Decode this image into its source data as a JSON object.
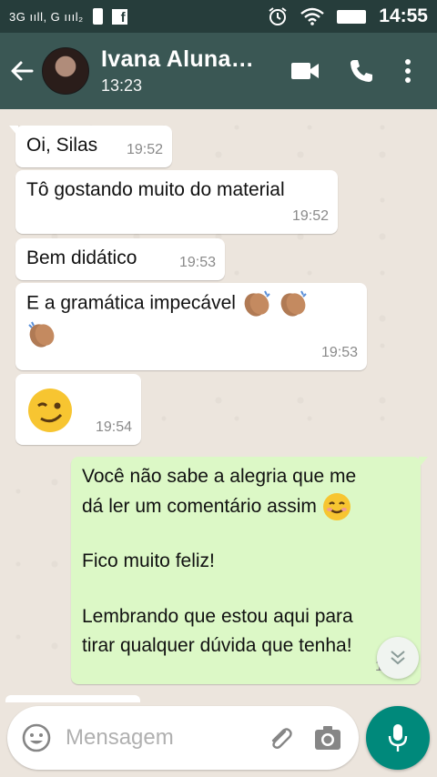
{
  "status_bar": {
    "signal_text": "3G ııll, G ıııl₂",
    "time": "14:55"
  },
  "header": {
    "contact_name": "Ivana Aluna…",
    "contact_status": "13:23"
  },
  "messages": [
    {
      "text": "Oi, Silas",
      "time": "19:52"
    },
    {
      "text": "Tô gostando muito do material",
      "time": "19:52"
    },
    {
      "text": "Bem didático",
      "time": "19:53"
    },
    {
      "text": "E a gramática impecável",
      "time": "19:53"
    },
    {
      "text": "",
      "time": "19:54"
    },
    {
      "line1": "Você não sabe a alegria que me",
      "line2": "dá ler um comentário assim",
      "line3": "Fico muito feliz!",
      "line4": "Lembrando que estou aqui para",
      "line5": "tirar qualquer dúvida que tenha!",
      "time": "19:55"
    }
  ],
  "input": {
    "placeholder": "Mensagem"
  },
  "colors": {
    "header_bg": "#3a5754",
    "incoming_bubble": "#ffffff",
    "outgoing_bubble": "#dcf8c6",
    "mic_button": "#00897b"
  }
}
